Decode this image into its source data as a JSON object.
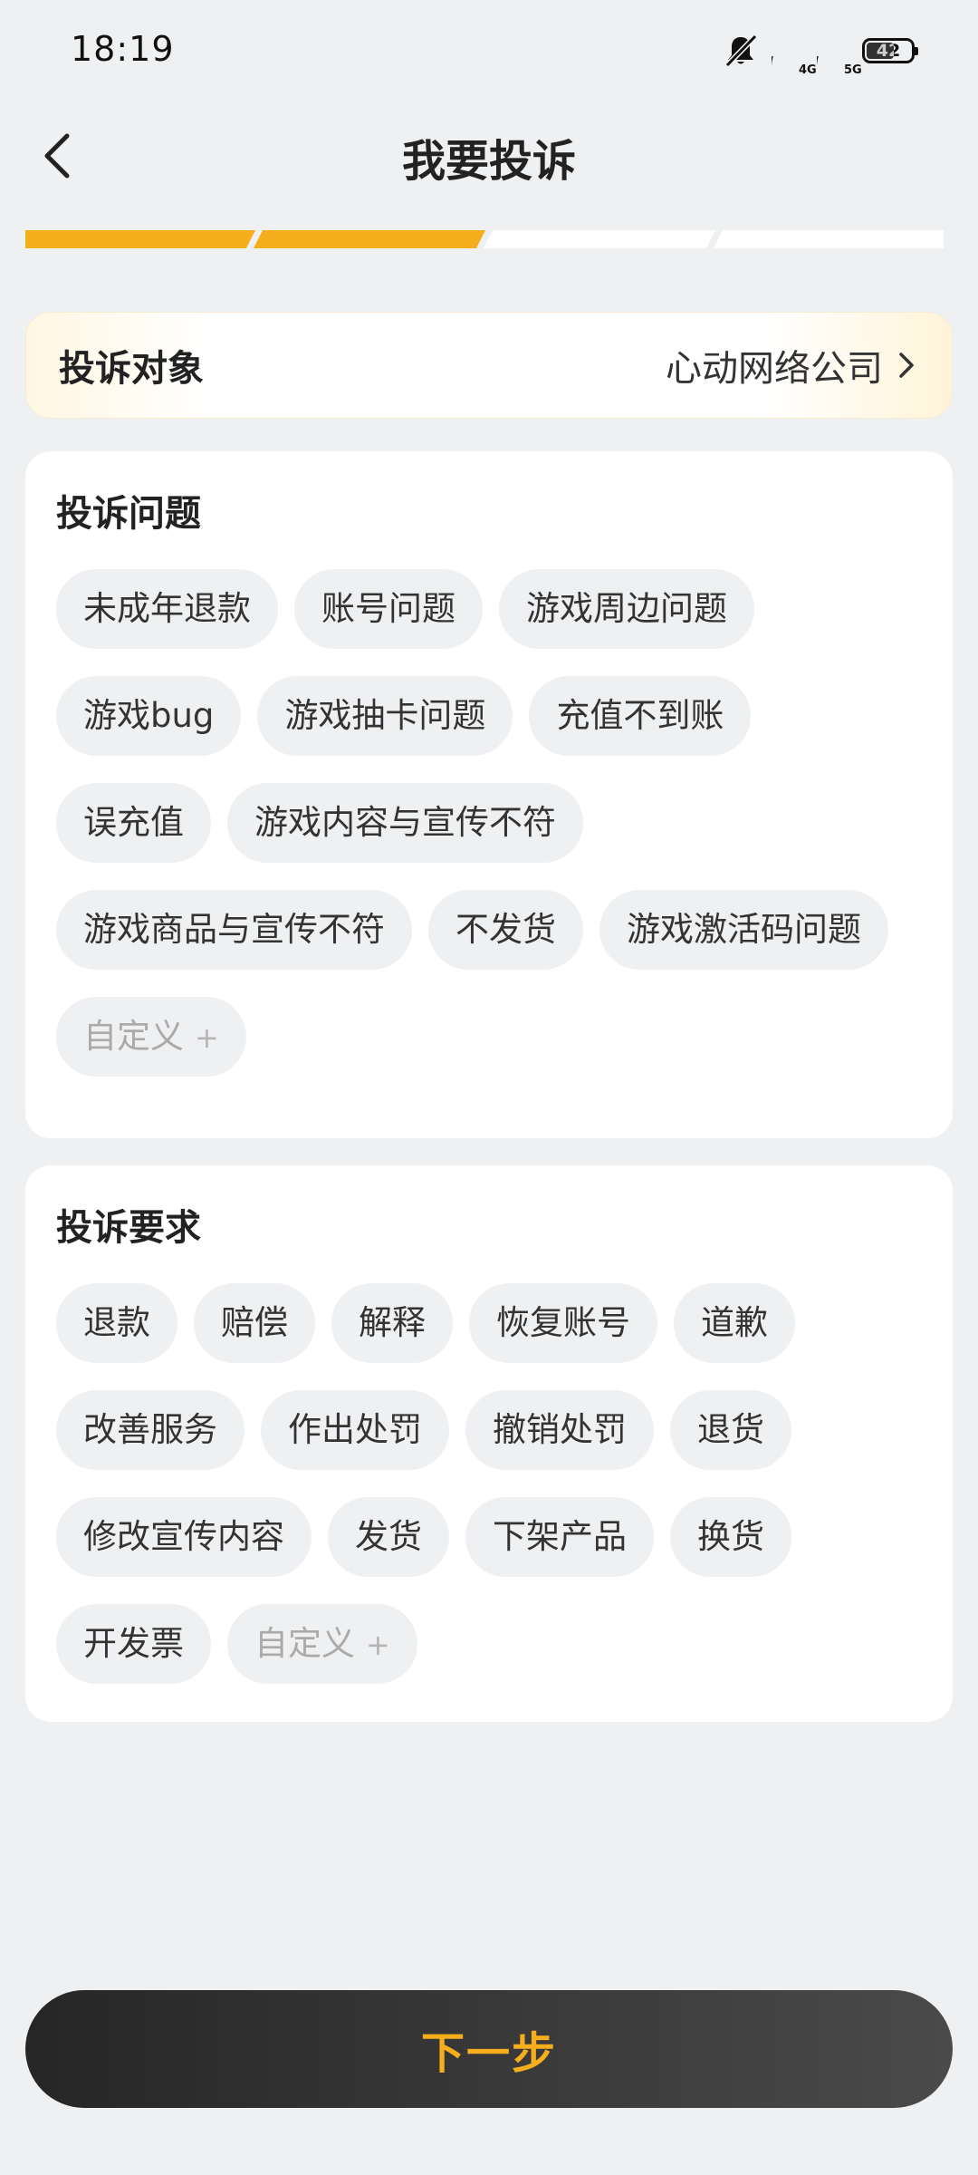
{
  "status_bar": {
    "time": "18:19",
    "net1": "4G",
    "net2": "5G",
    "battery": "42",
    "icons": [
      "mute-icon",
      "signal-icon",
      "battery-icon"
    ]
  },
  "header": {
    "title": "我要投诉",
    "back_icon": "chevron-left-icon"
  },
  "progress": {
    "total_steps": 4,
    "completed_steps": 2,
    "accent_color": "#f6ae1c"
  },
  "target": {
    "label": "投诉对象",
    "value": "心动网络公司"
  },
  "issues": {
    "title": "投诉问题",
    "tags": [
      "未成年退款",
      "账号问题",
      "游戏周边问题",
      "游戏bug",
      "游戏抽卡问题",
      "充值不到账",
      "误充值",
      "游戏内容与宣传不符",
      "游戏商品与宣传不符",
      "不发货",
      "游戏激活码问题"
    ],
    "custom_label": "自定义",
    "custom_plus": "+"
  },
  "requests": {
    "title": "投诉要求",
    "tags": [
      "退款",
      "赔偿",
      "解释",
      "恢复账号",
      "道歉",
      "改善服务",
      "作出处罚",
      "撤销处罚",
      "退货",
      "修改宣传内容",
      "发货",
      "下架产品",
      "换货",
      "开发票"
    ],
    "custom_label": "自定义",
    "custom_plus": "+"
  },
  "next_button": {
    "label": "下一步"
  }
}
